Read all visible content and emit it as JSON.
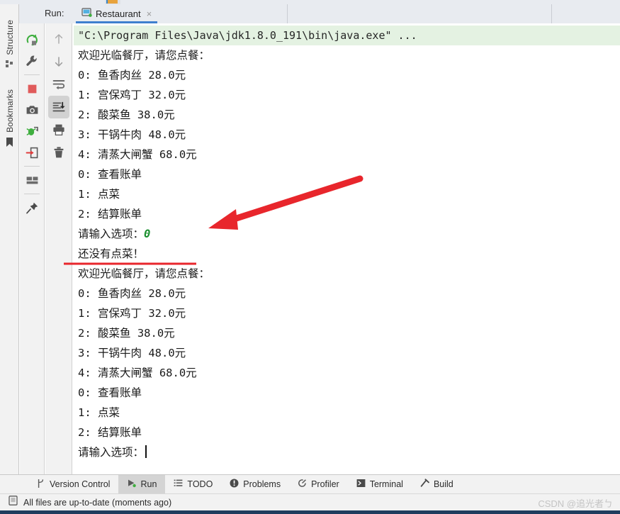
{
  "window": {
    "run_label": "Run:",
    "run_tab_title": "Restaurant",
    "run_tab_close": "×"
  },
  "left_rail": {
    "items": [
      {
        "label": "Structure",
        "icon": "structure-icon"
      },
      {
        "label": "Bookmarks",
        "icon": "bookmark-icon"
      }
    ]
  },
  "run_toolbar": {
    "buttons": [
      {
        "name": "rerun-icon",
        "title": "Rerun"
      },
      {
        "name": "wrench-icon",
        "title": "Edit Configuration"
      },
      {
        "name": "stop-icon",
        "title": "Stop"
      },
      {
        "name": "camera-icon",
        "title": "Capture Memory Snapshot"
      },
      {
        "name": "debug-attach-icon",
        "title": "Attach Debugger"
      },
      {
        "name": "import-icon",
        "title": "Import"
      },
      {
        "name": "layout-icon",
        "title": "Layout Settings"
      },
      {
        "name": "pin-icon",
        "title": "Pin Tab"
      }
    ]
  },
  "console_toolbar": {
    "buttons": [
      {
        "name": "up-arrow-icon",
        "title": "Previous Occurrence",
        "active": false
      },
      {
        "name": "down-arrow-icon",
        "title": "Next Occurrence",
        "active": false
      },
      {
        "name": "soft-wrap-icon",
        "title": "Soft-Wrap",
        "active": false
      },
      {
        "name": "scroll-to-end-icon",
        "title": "Scroll to End",
        "active": true
      },
      {
        "name": "print-icon",
        "title": "Print",
        "active": false
      },
      {
        "name": "trash-icon",
        "title": "Clear All",
        "active": false
      }
    ]
  },
  "console": {
    "lines": [
      {
        "text": "\"C:\\Program Files\\Java\\jdk1.8.0_191\\bin\\java.exe\" ...",
        "style": "cmd"
      },
      {
        "text": "欢迎光临餐厅，请您点餐：",
        "style": "out"
      },
      {
        "text": "0: 鱼香肉丝 28.0元",
        "style": "out"
      },
      {
        "text": "1: 宫保鸡丁 32.0元",
        "style": "out"
      },
      {
        "text": "2: 酸菜鱼 38.0元",
        "style": "out"
      },
      {
        "text": "3: 干锅牛肉 48.0元",
        "style": "out"
      },
      {
        "text": "4: 清蒸大闸蟹 68.0元",
        "style": "out"
      },
      {
        "text": "0: 查看账单",
        "style": "out"
      },
      {
        "text": "1: 点菜",
        "style": "out"
      },
      {
        "text": "2: 结算账单",
        "style": "out"
      },
      {
        "text": "请输入选项：",
        "style": "out",
        "input": "0"
      },
      {
        "text": "还没有点菜！",
        "style": "out"
      },
      {
        "text": "欢迎光临餐厅，请您点餐：",
        "style": "out"
      },
      {
        "text": "0: 鱼香肉丝 28.0元",
        "style": "out"
      },
      {
        "text": "1: 宫保鸡丁 32.0元",
        "style": "out"
      },
      {
        "text": "2: 酸菜鱼 38.0元",
        "style": "out"
      },
      {
        "text": "3: 干锅牛肉 48.0元",
        "style": "out"
      },
      {
        "text": "4: 清蒸大闸蟹 68.0元",
        "style": "out"
      },
      {
        "text": "0: 查看账单",
        "style": "out"
      },
      {
        "text": "1: 点菜",
        "style": "out"
      },
      {
        "text": "2: 结算账单",
        "style": "out"
      },
      {
        "text": "请输入选项：",
        "style": "out",
        "caret": true
      }
    ]
  },
  "annotations": {
    "arrow_color": "#e8262c",
    "underline_color": "#e8262c"
  },
  "bottom_tabs": [
    {
      "label": "Version Control",
      "icon": "branch-icon",
      "active": false
    },
    {
      "label": "Run",
      "icon": "run-play-icon",
      "active": true
    },
    {
      "label": "TODO",
      "icon": "todo-list-icon",
      "active": false
    },
    {
      "label": "Problems",
      "icon": "problems-icon",
      "active": false
    },
    {
      "label": "Profiler",
      "icon": "profiler-icon",
      "active": false
    },
    {
      "label": "Terminal",
      "icon": "terminal-icon",
      "active": false
    },
    {
      "label": "Build",
      "icon": "build-hammer-icon",
      "active": false
    }
  ],
  "status_bar": {
    "text": "All files are up-to-date (moments ago)",
    "icon": "file-sync-icon",
    "watermark": "CSDN @追光者ㄅ"
  }
}
